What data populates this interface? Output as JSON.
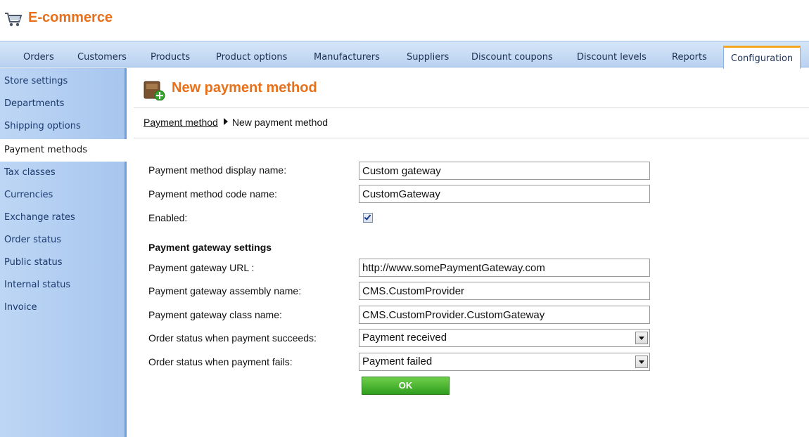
{
  "app": {
    "title": "E-commerce",
    "icon": "shopping-cart-icon",
    "accent_color": "#e8701a"
  },
  "tabs": [
    {
      "label": "Orders"
    },
    {
      "label": "Customers"
    },
    {
      "label": "Products"
    },
    {
      "label": "Product options"
    },
    {
      "label": "Manufacturers"
    },
    {
      "label": "Suppliers"
    },
    {
      "label": "Discount coupons"
    },
    {
      "label": "Discount levels"
    },
    {
      "label": "Reports"
    },
    {
      "label": "Configuration",
      "active": true
    }
  ],
  "sidebar": {
    "items": [
      {
        "label": "Store settings"
      },
      {
        "label": "Departments"
      },
      {
        "label": "Shipping options"
      },
      {
        "label": "Payment methods",
        "active": true
      },
      {
        "label": "Tax classes"
      },
      {
        "label": "Currencies"
      },
      {
        "label": "Exchange rates"
      },
      {
        "label": "Order status"
      },
      {
        "label": "Public status"
      },
      {
        "label": "Internal status"
      },
      {
        "label": "Invoice"
      }
    ]
  },
  "page": {
    "title": "New payment method",
    "icon": "new-payment-method-icon",
    "breadcrumb": {
      "parent": "Payment method",
      "current": "New payment method"
    }
  },
  "form": {
    "display_name_label": "Payment method display name:",
    "display_name_value": "Custom gateway",
    "code_name_label": "Payment method code name:",
    "code_name_value": "CustomGateway",
    "enabled_label": "Enabled:",
    "enabled": true,
    "gateway_section_title": "Payment gateway settings",
    "gateway_url_label": "Payment gateway URL :",
    "gateway_url_value": "http://www.somePaymentGateway.com",
    "assembly_label": "Payment gateway assembly name:",
    "assembly_value": "CMS.CustomProvider",
    "class_label": "Payment gateway class name:",
    "class_value": "CMS.CustomProvider.CustomGateway",
    "success_status_label": "Order status when payment succeeds:",
    "success_status_value": "Payment received",
    "fail_status_label": "Order status when payment fails:",
    "fail_status_value": "Payment failed",
    "ok_label": "OK"
  }
}
